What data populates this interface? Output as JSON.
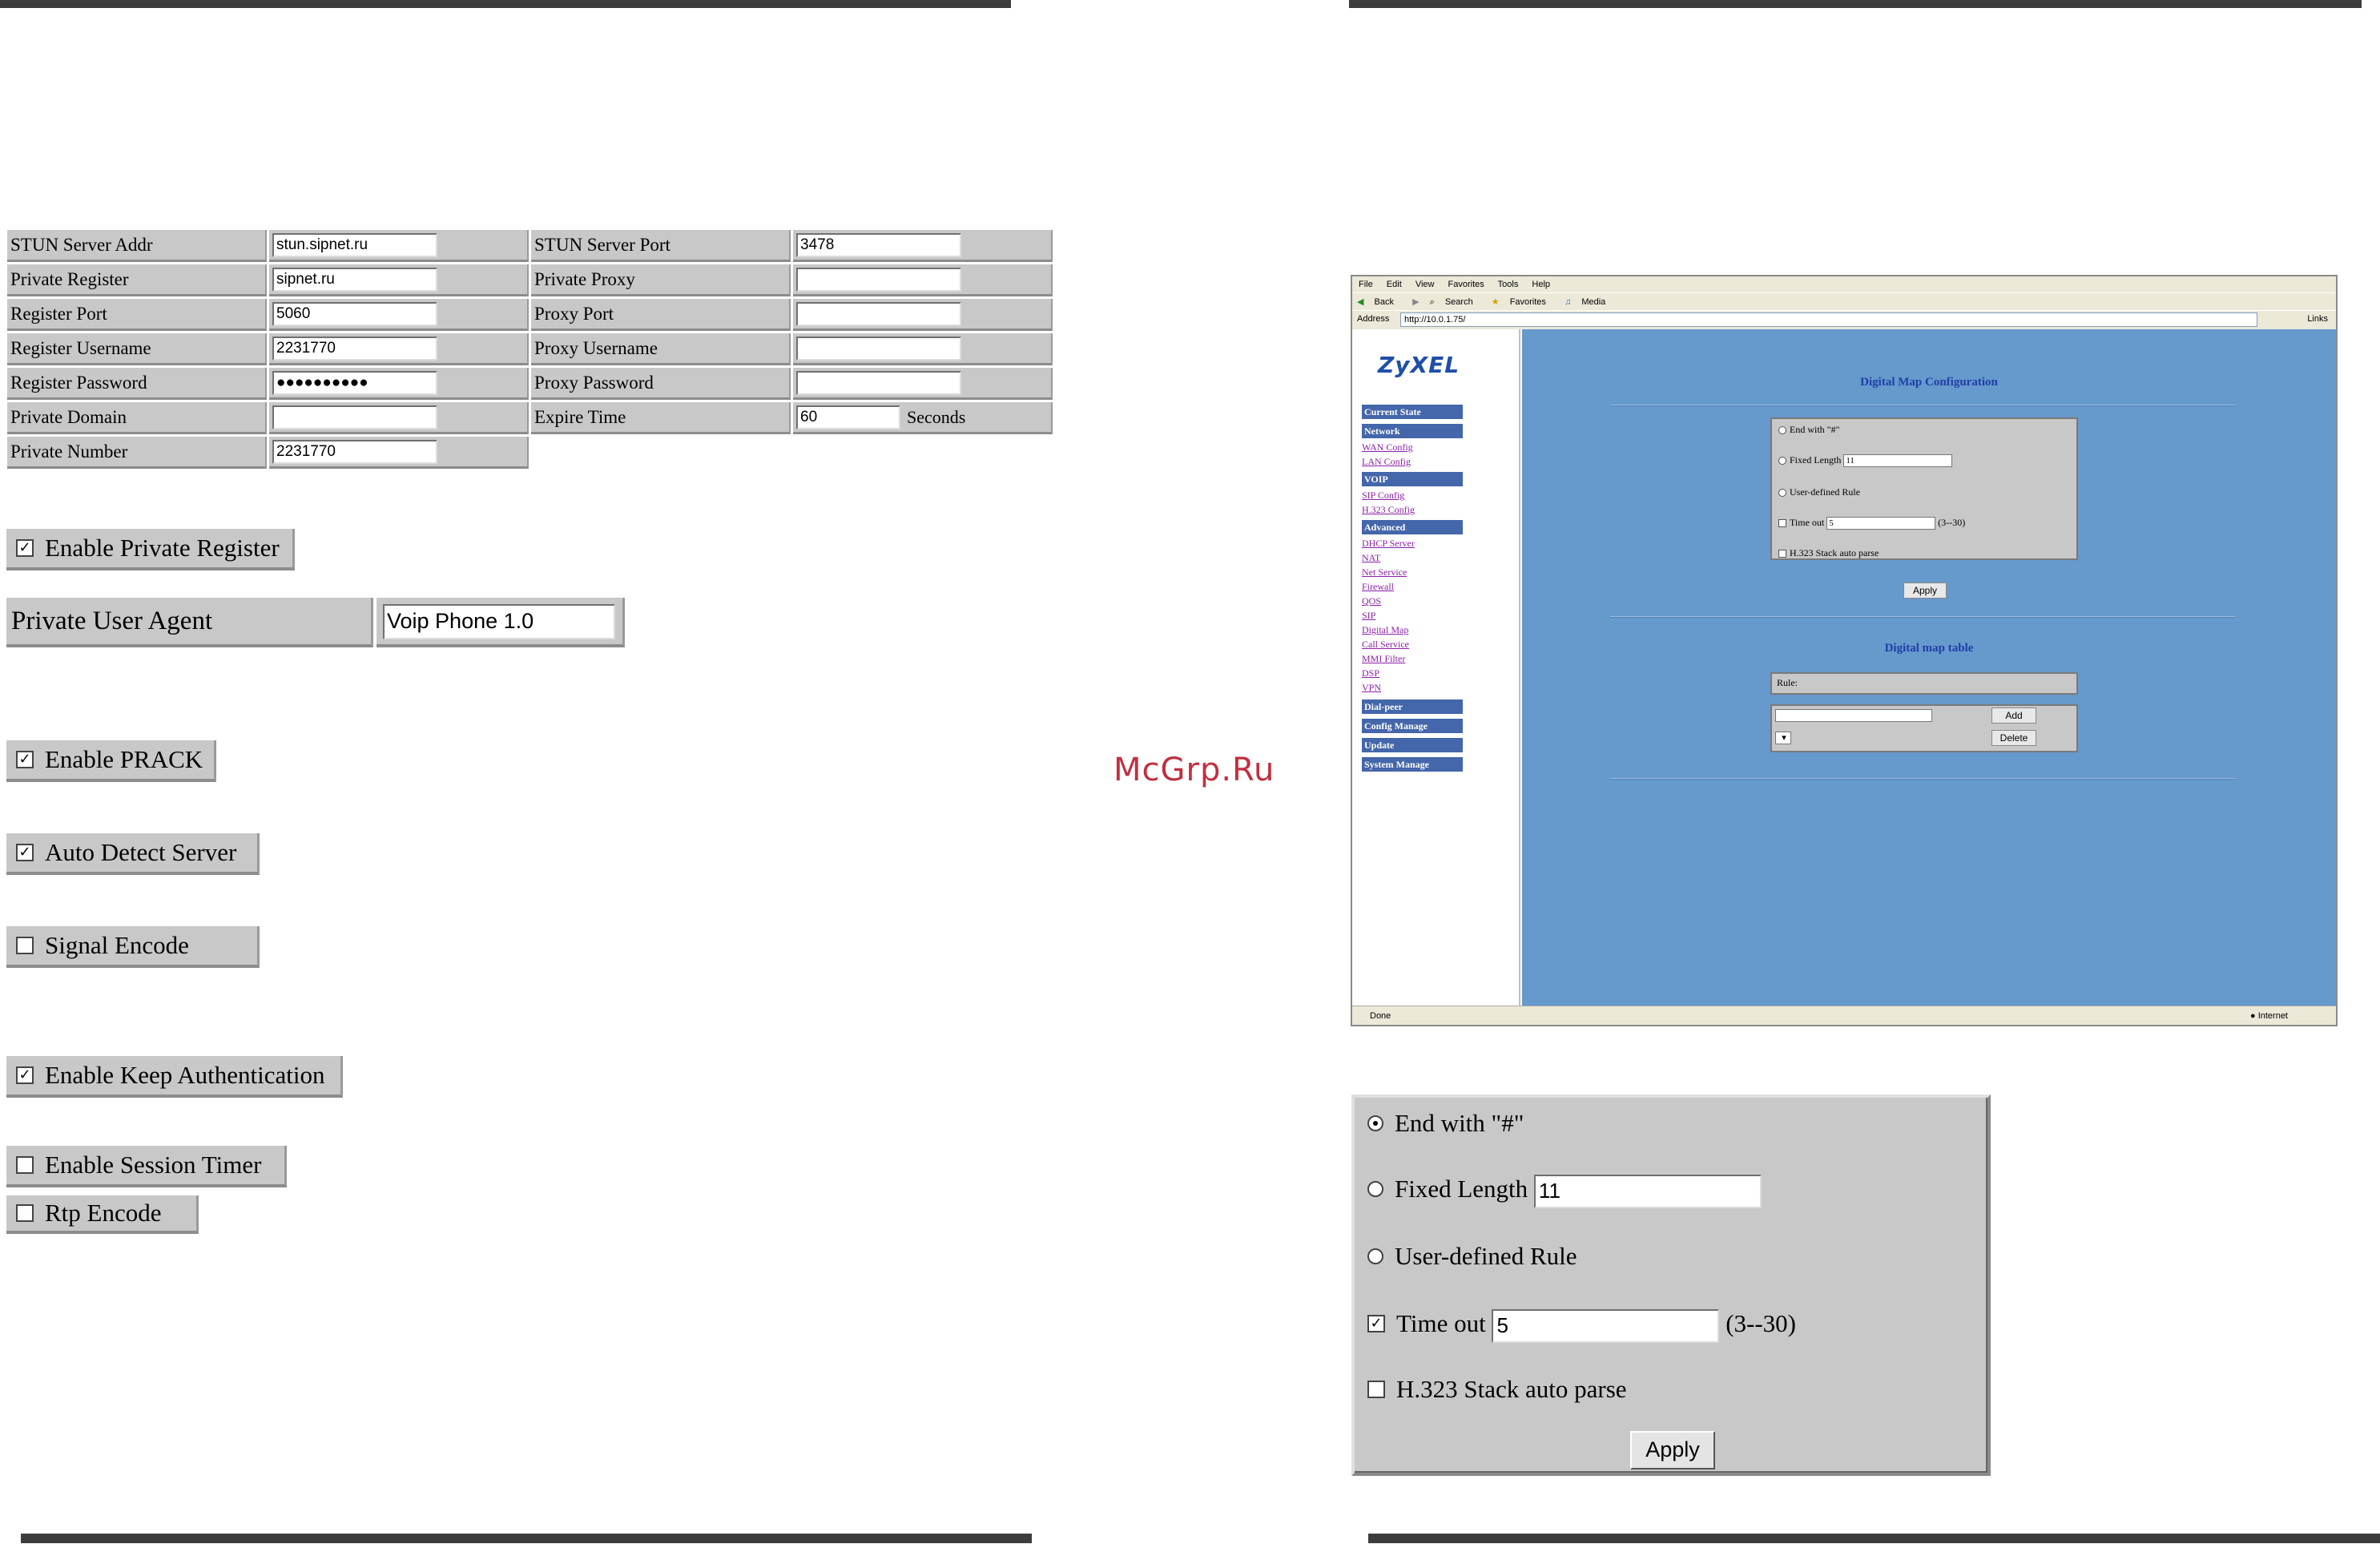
{
  "sip_table": {
    "rows": [
      {
        "label": "STUN Server Addr",
        "value": "stun.sipnet.ru",
        "label2": "STUN Server Port",
        "value2": "3478"
      },
      {
        "label": "Private Register",
        "value": "sipnet.ru",
        "label2": "Private Proxy",
        "value2": ""
      },
      {
        "label": "Register Port",
        "value": "5060",
        "label2": "Proxy Port",
        "value2": ""
      },
      {
        "label": "Register Username",
        "value": "2231770",
        "label2": "Proxy Username",
        "value2": ""
      },
      {
        "label": "Register Password",
        "value": "●●●●●●●●●●",
        "label2": "Proxy Password",
        "value2": ""
      },
      {
        "label": "Private Domain",
        "value": "",
        "label2": "Expire Time",
        "value2": "60",
        "unit": "Seconds"
      },
      {
        "label": "Private Number",
        "value": "2231770"
      }
    ]
  },
  "checkboxes": {
    "enable_private_register": {
      "label": "Enable Private Register",
      "checked": "✓"
    },
    "enable_prack": {
      "label": "Enable PRACK",
      "checked": "✓"
    },
    "auto_detect_server": {
      "label": "Auto Detect Server",
      "checked": "✓"
    },
    "signal_encode": {
      "label": "Signal Encode",
      "checked": ""
    },
    "enable_keep_auth": {
      "label": "Enable Keep Authentication",
      "checked": "✓"
    },
    "enable_session_timer": {
      "label": "Enable Session Timer",
      "checked": ""
    },
    "rtp_encode": {
      "label": "Rtp Encode",
      "checked": ""
    }
  },
  "private_user_agent": {
    "label": "Private User Agent",
    "value": "Voip Phone 1.0"
  },
  "watermark": "McGrp.Ru",
  "browser": {
    "menu": [
      "File",
      "Edit",
      "View",
      "Favorites",
      "Tools",
      "Help"
    ],
    "toolbar": [
      "Back",
      "Search",
      "Favorites",
      "Media"
    ],
    "address_label": "Address",
    "address": "http://10.0.1.75/",
    "links_label": "Links",
    "status": "Done",
    "zone": "Internet",
    "logo": "ZyXEL",
    "nav": {
      "current_state": "Current State",
      "network": "Network",
      "wan_config": "WAN Config",
      "lan_config": "LAN Config",
      "voip": "VOIP",
      "sip_config": "SIP Config",
      "h323_config": "H.323 Config",
      "advanced": "Advanced",
      "dhcp_server": "DHCP Server",
      "nat": "NAT",
      "net_service": "Net Service",
      "firewall": "Firewall",
      "qos": "QOS",
      "sip": "SIP",
      "digital_map": "Digital Map",
      "call_service": "Call Service",
      "mmi_filter": "MMI Filter",
      "dsp": "DSP",
      "vpn": "VPN",
      "dial_peer": "Dial-peer",
      "config_manage": "Config Manage",
      "update": "Update",
      "system_manage": "System Manage"
    },
    "content": {
      "title": "Digital Map Configuration",
      "end_with": "End with \"#\"",
      "fixed_length": "Fixed Length",
      "fixed_length_value": "11",
      "user_defined_rule": "User-defined Rule",
      "time_out": "Time out",
      "time_out_value": "5",
      "time_out_range": "(3--30)",
      "h323_auto_parse": "H.323 Stack auto parse",
      "apply": "Apply",
      "table_title": "Digital map table",
      "rule_label": "Rule:",
      "add": "Add",
      "delete": "Delete"
    }
  },
  "panel": {
    "end_with": "End with \"#\"",
    "fixed_length": "Fixed Length",
    "fixed_length_value": "11",
    "user_defined_rule": "User-defined Rule",
    "time_out": "Time out",
    "time_out_value": "5",
    "time_out_range": "(3--30)",
    "time_out_checked": "✓",
    "h323_auto_parse": "H.323 Stack auto parse",
    "apply": "Apply"
  }
}
